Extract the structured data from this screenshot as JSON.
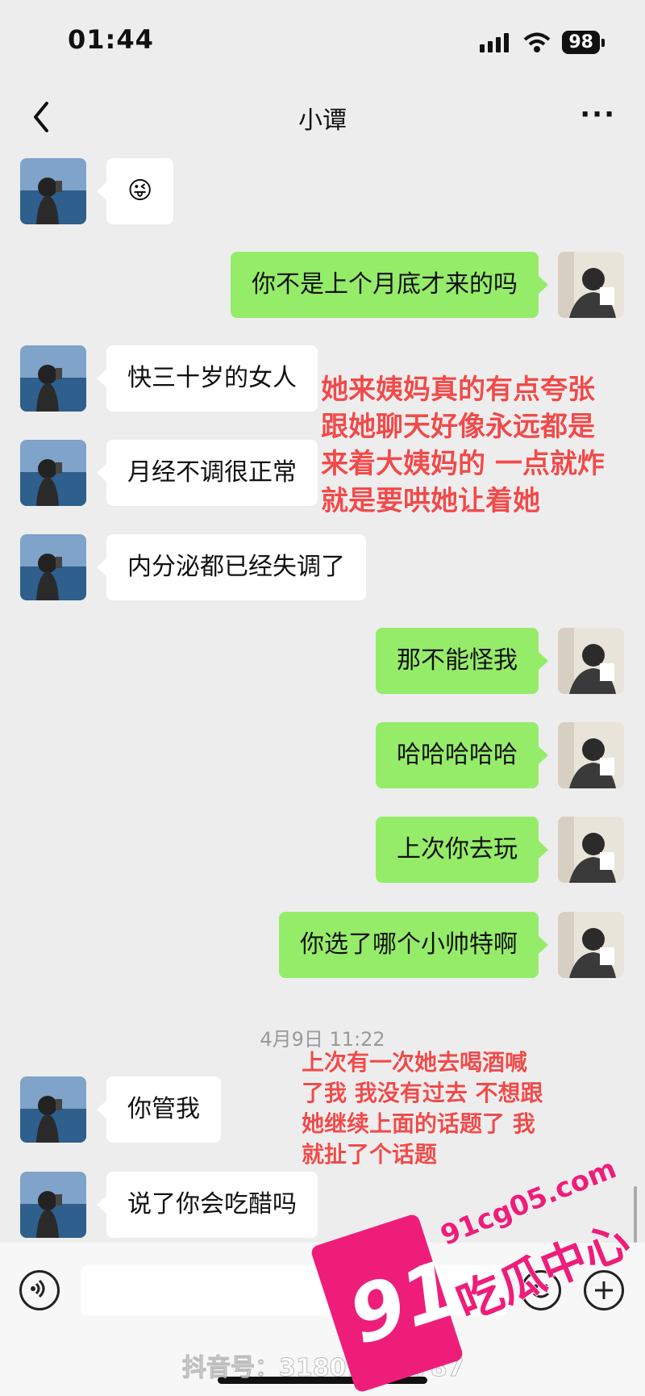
{
  "status": {
    "time": "01:44",
    "battery": "98"
  },
  "nav": {
    "title": "小谭",
    "more": "···"
  },
  "messages": [
    {
      "side": "left",
      "text": "😜"
    },
    {
      "side": "right",
      "text": "你不是上个月底才来的吗"
    },
    {
      "side": "left",
      "text": "快三十岁的女人"
    },
    {
      "side": "left",
      "text": "月经不调很正常"
    },
    {
      "side": "left",
      "text": "内分泌都已经失调了"
    },
    {
      "side": "right",
      "text": "那不能怪我"
    },
    {
      "side": "right",
      "text": "哈哈哈哈哈"
    },
    {
      "side": "right",
      "text": "上次你去玩"
    },
    {
      "side": "right",
      "text": "你选了哪个小帅特啊"
    },
    {
      "side": "left",
      "text": "你管我"
    },
    {
      "side": "left",
      "text": "说了你会吃醋吗"
    }
  ],
  "datestamp": "4月9日 11:22",
  "annotations": {
    "first": [
      "她来姨妈真的有点夸张",
      "跟她聊天好像永远都是",
      "来着大姨妈的 一点就炸",
      "就是要哄她让着她"
    ],
    "second": [
      "上次有一次她去喝酒喊",
      "了我 我没有过去 不想跟",
      "她继续上面的话题了 我",
      "就扯了个话题"
    ]
  },
  "watermark": {
    "number": "91",
    "url": "91cg05.com",
    "name": "吃瓜中心",
    "douyin": "抖音号：31807 88 787"
  },
  "colors": {
    "bg": "#ededed",
    "self_bubble": "#95ec69",
    "peer_bubble": "#ffffff",
    "annotation": "#f04a4a",
    "watermark": "#ee1d7a"
  },
  "icons": {
    "back": "chevron-left-icon",
    "voice": "voice-icon",
    "emoji": "emoji-icon",
    "plus": "plus-icon"
  }
}
